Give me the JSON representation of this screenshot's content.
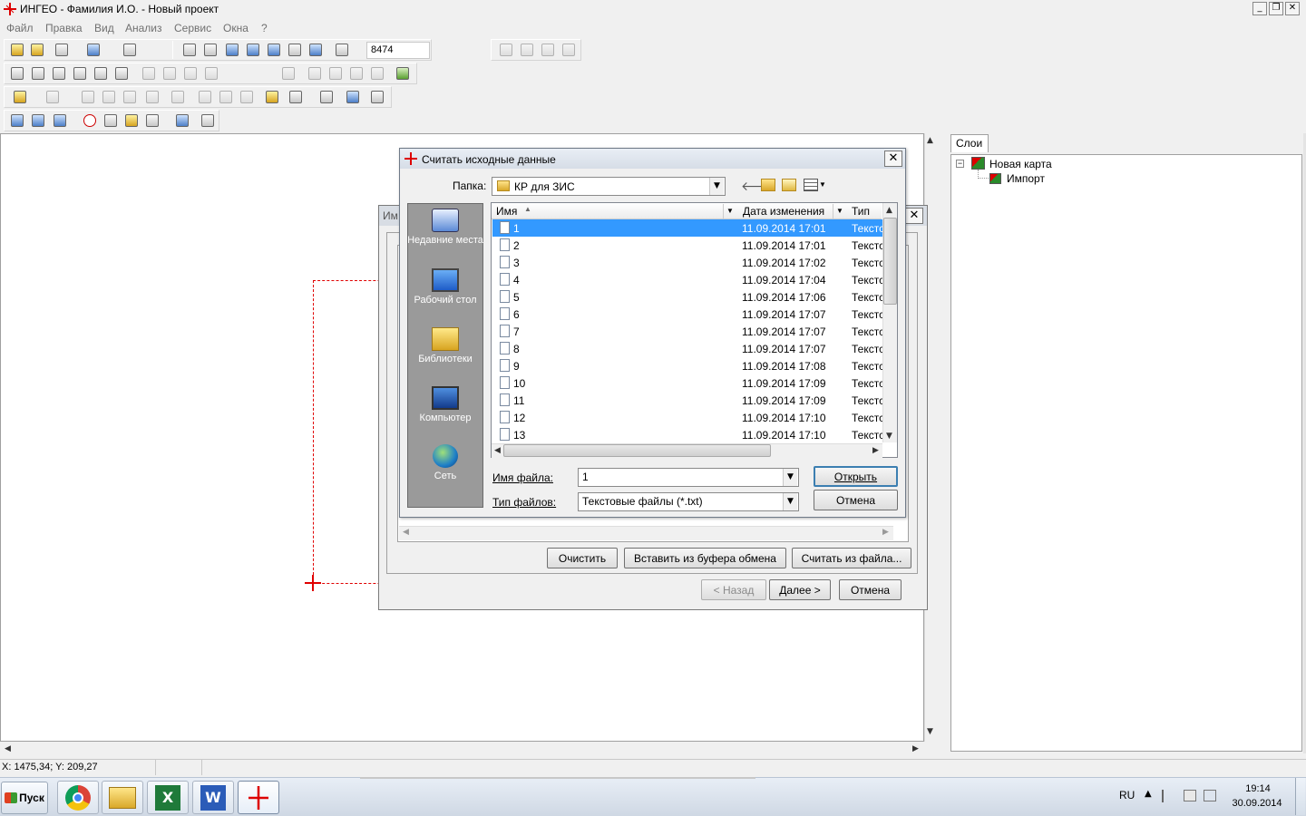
{
  "window": {
    "title": "ИНГЕО - Фамилия И.О. - Новый проект",
    "min": "_",
    "restore": "❐",
    "close": "✕"
  },
  "menu": [
    "Файл",
    "Правка",
    "Вид",
    "Анализ",
    "Сервис",
    "Окна",
    "?"
  ],
  "toolbar": {
    "scale_value": "8474"
  },
  "layers": {
    "tab": "Слои",
    "tree": [
      {
        "label": "Новая карта",
        "children": [
          "Импорт"
        ]
      }
    ]
  },
  "status": {
    "coords": "X: 1475,34; Y: 209,27"
  },
  "wizard": {
    "title": "Им",
    "clear": "Очистить",
    "paste": "Вставить из буфера обмена",
    "read_file": "Считать из файла...",
    "back": "< Назад",
    "next": "Далее >",
    "cancel": "Отмена"
  },
  "file_dialog": {
    "title": "Считать исходные данные",
    "folder_label": "Папка:",
    "folder": "КР для ЗИС",
    "places": [
      "Недавние места",
      "Рабочий стол",
      "Библиотеки",
      "Компьютер",
      "Сеть"
    ],
    "columns": [
      "Имя",
      "Дата изменения",
      "Тип"
    ],
    "files": [
      {
        "name": "1",
        "date": "11.09.2014 17:01",
        "type": "Текстс"
      },
      {
        "name": "2",
        "date": "11.09.2014 17:01",
        "type": "Текстс"
      },
      {
        "name": "3",
        "date": "11.09.2014 17:02",
        "type": "Текстс"
      },
      {
        "name": "4",
        "date": "11.09.2014 17:04",
        "type": "Текстс"
      },
      {
        "name": "5",
        "date": "11.09.2014 17:06",
        "type": "Текстс"
      },
      {
        "name": "6",
        "date": "11.09.2014 17:07",
        "type": "Текстс"
      },
      {
        "name": "7",
        "date": "11.09.2014 17:07",
        "type": "Текстс"
      },
      {
        "name": "8",
        "date": "11.09.2014 17:07",
        "type": "Текстс"
      },
      {
        "name": "9",
        "date": "11.09.2014 17:08",
        "type": "Текстс"
      },
      {
        "name": "10",
        "date": "11.09.2014 17:09",
        "type": "Текстс"
      },
      {
        "name": "11",
        "date": "11.09.2014 17:09",
        "type": "Текстс"
      },
      {
        "name": "12",
        "date": "11.09.2014 17:10",
        "type": "Текстс"
      },
      {
        "name": "13",
        "date": "11.09.2014 17:10",
        "type": "Текстс"
      }
    ],
    "filename_label": "Имя файла:",
    "filename": "1",
    "filetype_label": "Тип файлов:",
    "filetype": "Текстовые файлы (*.txt)",
    "open": "Открыть",
    "cancel": "Отмена"
  },
  "taskbar": {
    "start": "Пуск",
    "lang": "RU",
    "time": "19:14",
    "date": "30.09.2014"
  },
  "colors": {
    "selection": "#3399ff",
    "marker": "#e00000",
    "places_bg": "#9a9a9a"
  }
}
